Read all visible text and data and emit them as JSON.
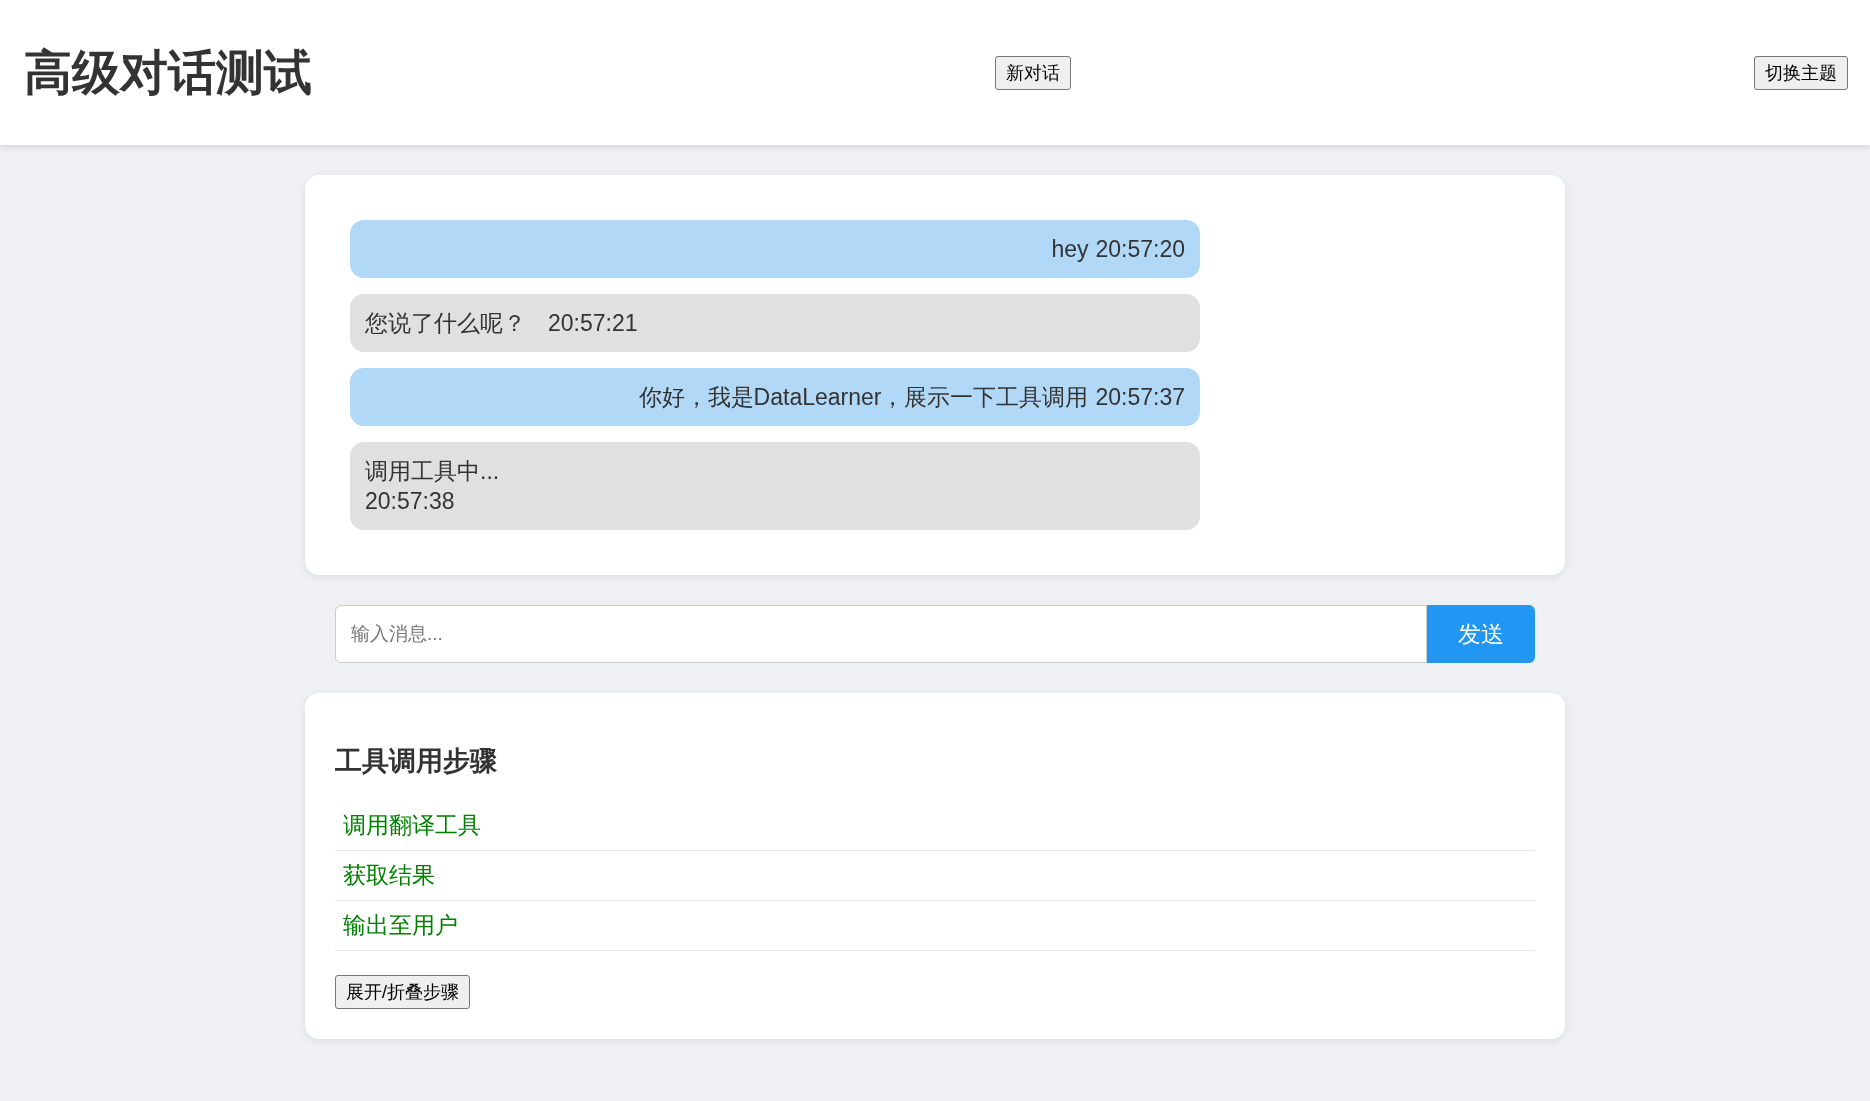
{
  "header": {
    "title": "高级对话测试",
    "new_chat_button": "新对话",
    "theme_button": "切换主题"
  },
  "messages": [
    {
      "kind": "user",
      "text": "hey",
      "time": "20:57:20"
    },
    {
      "kind": "assistant",
      "text": "您说了什么呢？",
      "time": "20:57:21"
    },
    {
      "kind": "user",
      "text": "你好，我是DataLearner，展示一下工具调用",
      "time": "20:57:37"
    },
    {
      "kind": "tool",
      "text": "调用工具中...",
      "time": "20:57:38"
    }
  ],
  "composer": {
    "placeholder": "输入消息...",
    "send_button": "发送"
  },
  "steps_panel": {
    "title": "工具调用步骤",
    "steps": [
      "调用翻译工具",
      "获取结果",
      "输出至用户"
    ],
    "toggle_button": "展开/折叠步骤"
  }
}
